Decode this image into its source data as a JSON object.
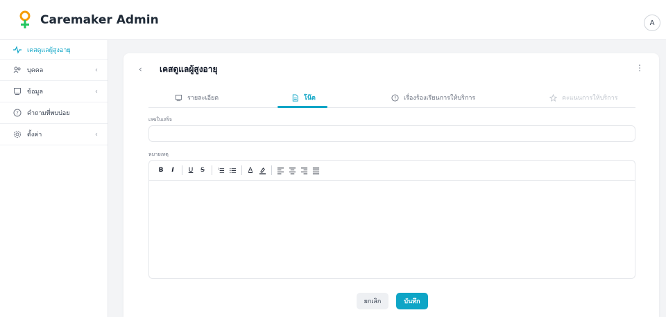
{
  "app": {
    "brand": "Caremaker Admin",
    "avatar_initial": "A"
  },
  "sidebar": {
    "items": [
      {
        "label": "เคสดูแลผู้สูงอายุ",
        "icon": "activity-icon",
        "active": true
      },
      {
        "label": "บุคคล",
        "icon": "users-icon",
        "has_children": true
      },
      {
        "label": "ข้อมูล",
        "icon": "monitor-icon",
        "has_children": true
      },
      {
        "label": "คำถามที่พบบ่อย",
        "icon": "help-circle-icon"
      },
      {
        "label": "ตั้งค่า",
        "icon": "gear-icon",
        "has_children": true
      }
    ]
  },
  "page": {
    "title": "เคสดูแลผู้สูงอายุ"
  },
  "tabs": [
    {
      "label": "รายละเอียด",
      "icon": "monitor-icon"
    },
    {
      "label": "โน๊ต",
      "icon": "file-text-icon",
      "active": true
    },
    {
      "label": "เรื่องร้องเรียนการให้บริการ",
      "icon": "alert-circle-icon"
    },
    {
      "label": "คะแนนการให้บริการ",
      "icon": "star-icon",
      "disabled": true
    }
  ],
  "form": {
    "case_number_label": "เลขใบเสร็จ",
    "case_number_value": "",
    "note_label": "หมายเหตุ",
    "toolbar": [
      "B",
      "I",
      "U",
      "S",
      "ordered-list",
      "bullet-list",
      "text-color",
      "highlight",
      "align-left",
      "align-center",
      "align-right",
      "justify"
    ]
  },
  "buttons": {
    "cancel": "ยกเลิก",
    "save": "บันทึก"
  },
  "colors": {
    "accent": "#0ea5c6",
    "brand_green": "#22c55e",
    "brand_orange": "#f59e0b"
  }
}
